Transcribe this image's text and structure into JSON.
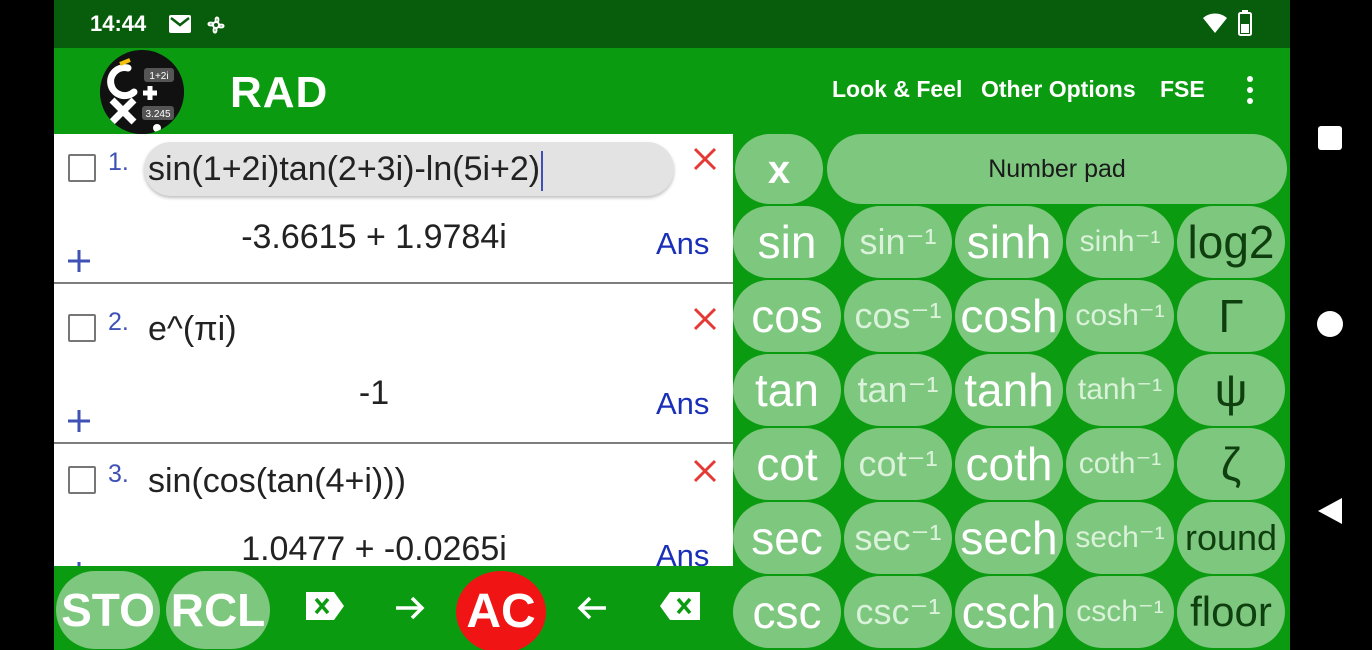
{
  "status": {
    "time": "14:44"
  },
  "appbar": {
    "mode": "RAD",
    "menu": [
      "Look & Feel",
      "Other Options",
      "FSE"
    ]
  },
  "logo": {
    "tl": "1+2i",
    "bl": "3.245"
  },
  "history": [
    {
      "num": "1.",
      "expr": "sin(1+2i)tan(2+3i)-ln(5i+2)",
      "result": "-3.6615 + 1.9784i",
      "ans": "Ans"
    },
    {
      "num": "2.",
      "expr": "e^(πi)",
      "result": "-1",
      "ans": "Ans"
    },
    {
      "num": "3.",
      "expr": "sin(cos(tan(4+i)))",
      "result": "1.0477 + -0.0265i",
      "ans": "Ans"
    }
  ],
  "toolbar": {
    "sto": "STO",
    "rcl": "RCL",
    "ac": "AC"
  },
  "keypad": {
    "x": "x",
    "numpad": "Number pad",
    "rows": [
      [
        "sin",
        "sin⁻¹",
        "sinh",
        "sinh⁻¹",
        "log2"
      ],
      [
        "cos",
        "cos⁻¹",
        "cosh",
        "cosh⁻¹",
        "Γ"
      ],
      [
        "tan",
        "tan⁻¹",
        "tanh",
        "tanh⁻¹",
        "ψ"
      ],
      [
        "cot",
        "cot⁻¹",
        "coth",
        "coth⁻¹",
        "ζ"
      ],
      [
        "sec",
        "sec⁻¹",
        "sech",
        "sech⁻¹",
        "round"
      ],
      [
        "csc",
        "csc⁻¹",
        "csch",
        "csch⁻¹",
        "floor"
      ]
    ]
  },
  "colors": {
    "app_green": "#0b9b10",
    "status_green": "#075d0b",
    "key_green": "#7ec77e",
    "ac_red": "#f11414",
    "close_red": "#e53935",
    "ans_blue": "#1a2fb8"
  }
}
